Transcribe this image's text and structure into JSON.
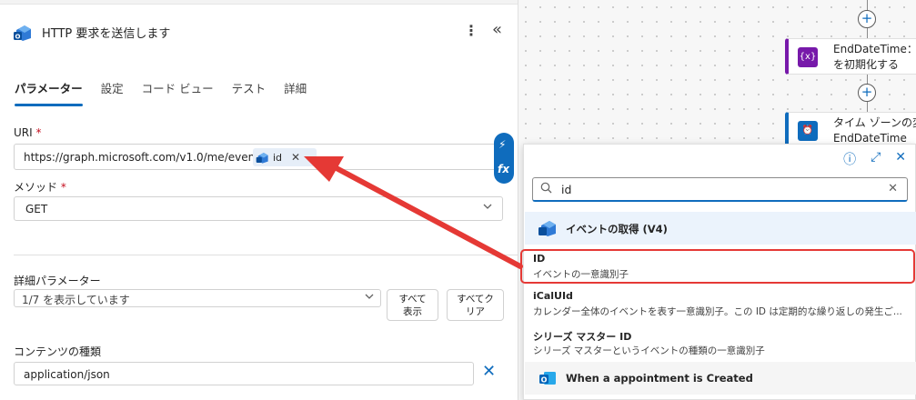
{
  "panel": {
    "title": "HTTP 要求を送信します",
    "kebab": "⋮",
    "collapse": "«"
  },
  "tabs": [
    {
      "label": "パラメーター",
      "active": true
    },
    {
      "label": "設定",
      "active": false
    },
    {
      "label": "コード ビュー",
      "active": false
    },
    {
      "label": "テスト",
      "active": false
    },
    {
      "label": "詳細",
      "active": false
    }
  ],
  "uri": {
    "label": "URI",
    "required_mark": "*",
    "value": "https://graph.microsoft.com/v1.0/me/events/",
    "token": "id",
    "token_remove": "✕"
  },
  "method": {
    "label": "メソッド",
    "required_mark": "*",
    "value": "GET"
  },
  "advanced": {
    "label": "詳細パラメーター",
    "value": "1/7 を表示しています",
    "show_all_line1": "すべて",
    "show_all_line2": "表示",
    "clear_all_line1": "すべてク",
    "clear_all_line2": "リア"
  },
  "content_type": {
    "label": "コンテンツの種類",
    "value": "application/json",
    "remove": "✕"
  },
  "side_tools": {
    "lightning": "⚡",
    "fx": "fx"
  },
  "canvas": {
    "nodes": [
      {
        "line1": "EndDateTime：変",
        "line2": "を初期化する",
        "icon_text": "{x}",
        "color": "#7719aa"
      },
      {
        "line1": "タイム ゾーンの変",
        "line2": "EndDateTime",
        "icon_text": "⏰",
        "color": "#0f6cbd"
      }
    ],
    "add_symbol": "+"
  },
  "popup": {
    "info_icon": "ⓘ",
    "expand_icon": "⤢",
    "close_icon": "✕",
    "search_value": "id",
    "search_clear": "✕",
    "group_title": "イベントの取得 (V4)",
    "items": [
      {
        "title": "ID",
        "desc": "イベントの一意識別子"
      },
      {
        "title": "iCalUId",
        "desc": "カレンダー全体のイベントを表す一意識別子。この ID は定期的な繰り返しの発生ご..."
      },
      {
        "title": "シリーズ マスター ID",
        "desc": "シリーズ マスターというイベントの種類の一意識別子"
      }
    ],
    "group2_title": "When a appointment is Created"
  },
  "colors": {
    "accent": "#0f6cbd",
    "highlight": "#e53935",
    "variable": "#7719aa"
  }
}
